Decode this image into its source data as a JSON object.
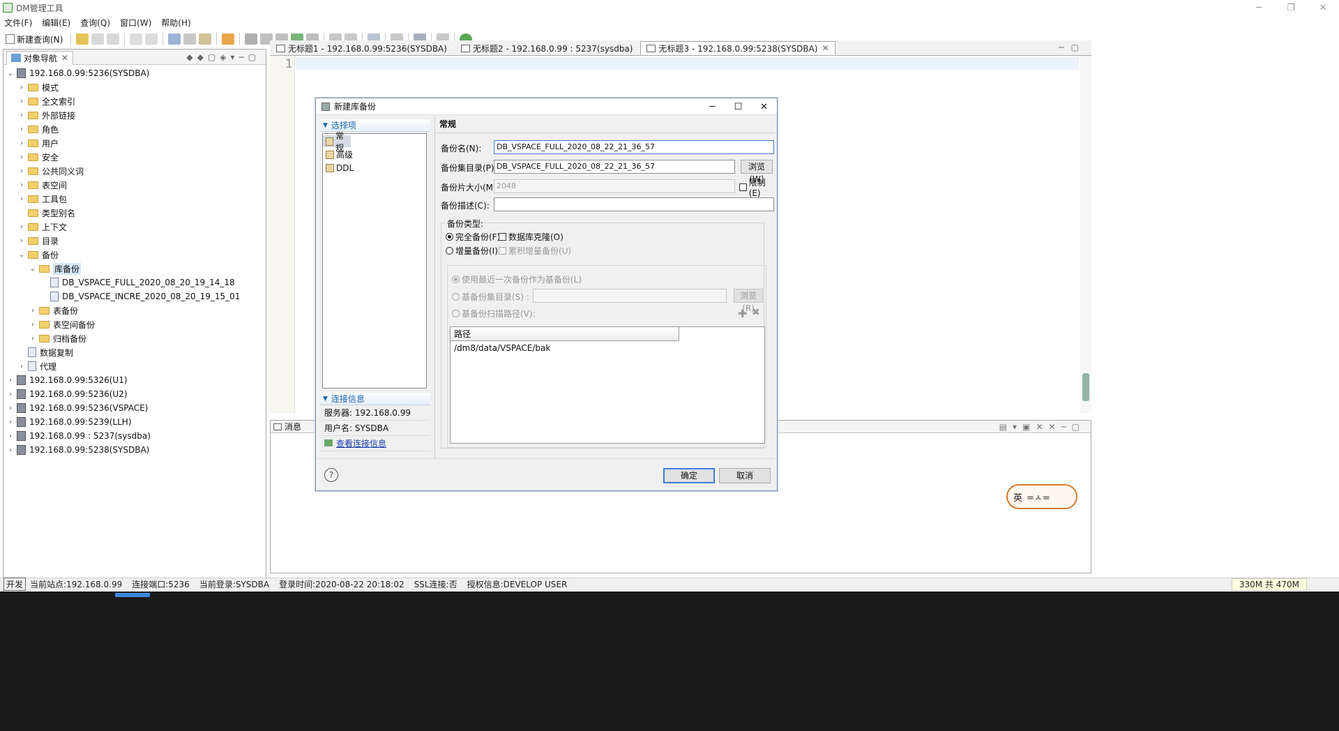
{
  "window": {
    "title": "DM管理工具"
  },
  "menu": [
    "文件(F)",
    "编辑(E)",
    "查询(Q)",
    "窗口(W)",
    "帮助(H)"
  ],
  "toolbar": {
    "new_query": "新建查询(N)"
  },
  "nav": {
    "title": "对象导航",
    "tree": [
      {
        "label": "192.168.0.99:5236(SYSDBA)",
        "level": 0,
        "tw": "v",
        "icon": "db"
      },
      {
        "label": "模式",
        "level": 1,
        "tw": ">",
        "icon": "folder"
      },
      {
        "label": "全文索引",
        "level": 1,
        "tw": ">",
        "icon": "folder"
      },
      {
        "label": "外部链接",
        "level": 1,
        "tw": ">",
        "icon": "folder"
      },
      {
        "label": "角色",
        "level": 1,
        "tw": ">",
        "icon": "folder"
      },
      {
        "label": "用户",
        "level": 1,
        "tw": ">",
        "icon": "folder"
      },
      {
        "label": "安全",
        "level": 1,
        "tw": ">",
        "icon": "folder"
      },
      {
        "label": "公共同义词",
        "level": 1,
        "tw": ">",
        "icon": "folder"
      },
      {
        "label": "表空间",
        "level": 1,
        "tw": ">",
        "icon": "folder"
      },
      {
        "label": "工具包",
        "level": 1,
        "tw": ">",
        "icon": "folder"
      },
      {
        "label": "类型别名",
        "level": 1,
        "tw": "",
        "icon": "folder"
      },
      {
        "label": "上下文",
        "level": 1,
        "tw": ">",
        "icon": "folder"
      },
      {
        "label": "目录",
        "level": 1,
        "tw": ">",
        "icon": "folder"
      },
      {
        "label": "备份",
        "level": 1,
        "tw": "v",
        "icon": "folder"
      },
      {
        "label": "库备份",
        "level": 2,
        "tw": "v",
        "icon": "folder",
        "selected": true
      },
      {
        "label": "DB_VSPACE_FULL_2020_08_20_19_14_18",
        "level": 3,
        "tw": "",
        "icon": "file"
      },
      {
        "label": "DB_VSPACE_INCRE_2020_08_20_19_15_01",
        "level": 3,
        "tw": "",
        "icon": "file"
      },
      {
        "label": "表备份",
        "level": 2,
        "tw": ">",
        "icon": "folder"
      },
      {
        "label": "表空间备份",
        "level": 2,
        "tw": ">",
        "icon": "folder"
      },
      {
        "label": "归档备份",
        "level": 2,
        "tw": ">",
        "icon": "folder"
      },
      {
        "label": "数据复制",
        "level": 1,
        "tw": "",
        "icon": "file"
      },
      {
        "label": "代理",
        "level": 1,
        "tw": ">",
        "icon": "file"
      },
      {
        "label": "192.168.0.99:5326(U1)",
        "level": 0,
        "tw": ">",
        "icon": "db"
      },
      {
        "label": "192.168.0.99:5236(U2)",
        "level": 0,
        "tw": ">",
        "icon": "db"
      },
      {
        "label": "192.168.0.99:5236(VSPACE)",
        "level": 0,
        "tw": ">",
        "icon": "db"
      },
      {
        "label": "192.168.0.99:5239(LLH)",
        "level": 0,
        "tw": ">",
        "icon": "db"
      },
      {
        "label": "192.168.0.99 : 5237(sysdba)",
        "level": 0,
        "tw": ">",
        "icon": "db"
      },
      {
        "label": "192.168.0.99:5238(SYSDBA)",
        "level": 0,
        "tw": ">",
        "icon": "db"
      }
    ]
  },
  "editor": {
    "tabs": [
      {
        "label": "无标题1 - 192.168.0.99:5236(SYSDBA)",
        "active": false
      },
      {
        "label": "无标题2 - 192.168.0.99 : 5237(sysdba)",
        "active": false
      },
      {
        "label": "无标题3 - 192.168.0.99:5238(SYSDBA)",
        "active": true
      }
    ],
    "line_number": "1"
  },
  "messages": {
    "title": "消息"
  },
  "dialog": {
    "title": "新建库备份",
    "options_header": "选择项",
    "options": [
      "常规",
      "高级",
      "DDL"
    ],
    "conn_header": "连接信息",
    "server_label": "服务器: 192.168.0.99",
    "user_label": "用户名: SYSDBA",
    "view_conn": "查看连接信息",
    "section": "常规",
    "backup_name_label": "备份名(N):",
    "backup_name": "DB_VSPACE_FULL_2020_08_22_21_36_57",
    "backup_dir_label": "备份集目录(P):",
    "backup_dir": "DB_VSPACE_FULL_2020_08_22_21_36_57",
    "browse": "浏览(W)",
    "piece_size_label": "备份片大小(M):",
    "piece_size": "2048",
    "limit": "限制(E)",
    "desc_label": "备份描述(C):",
    "desc": "",
    "type_label": "备份类型:",
    "full": "完全备份(F)",
    "clone": "数据库克隆(O)",
    "incr": "增量备份(I)",
    "cumulative": "累积增量备份(U)",
    "use_recent": "使用最近一次备份作为基备份(L)",
    "base_dir_label": "基备份集目录(S) :",
    "browse_r": "浏览(R)",
    "base_scan_label": "基备份扫描路径(V):",
    "path_col": "路径",
    "path_val": "/dm8/data/VSPACE/bak",
    "ok": "确定",
    "cancel": "取消"
  },
  "status": {
    "mode": "开发",
    "site": "当前站点:192.168.0.99",
    "port": "连接端口:5236",
    "login": "当前登录:SYSDBA",
    "time": "登录时间:2020-08-22 20:18:02",
    "ssl": "SSL连接:否",
    "auth": "授权信息:DEVELOP USER",
    "mem": "330M 共 470M"
  },
  "sticker": {
    "text": "英"
  }
}
